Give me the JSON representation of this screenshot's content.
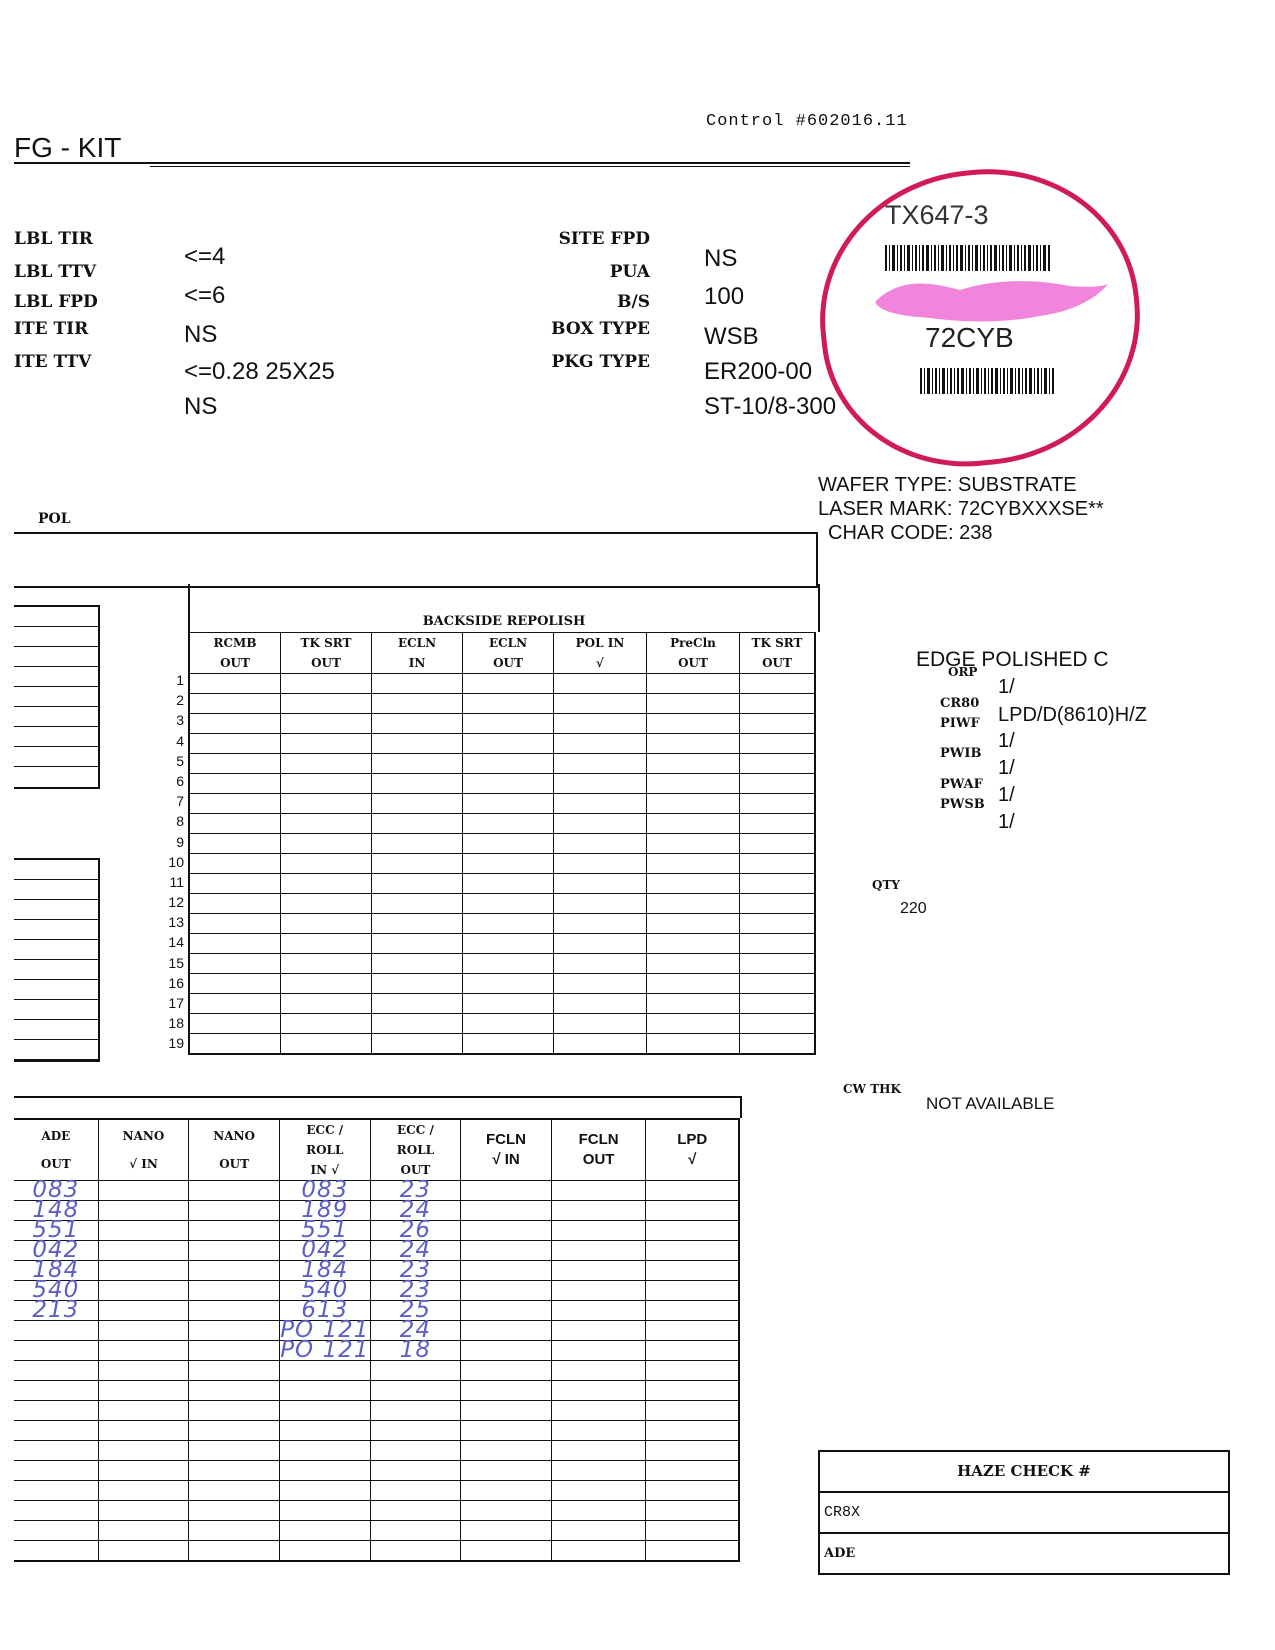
{
  "header": {
    "control": "Control #602016.11",
    "title": "FG - KIT"
  },
  "specs_left": [
    {
      "label": "LBL TIR",
      "value": "<=4"
    },
    {
      "label": "LBL TTV",
      "value": "<=6"
    },
    {
      "label": "LBL FPD",
      "value": "NS"
    },
    {
      "label": "ITE TIR",
      "value": "<=0.28 25X25"
    },
    {
      "label": "ITE TTV",
      "value": "NS"
    }
  ],
  "specs_right": [
    {
      "label": "SITE FPD",
      "value": "NS"
    },
    {
      "label": "PUA",
      "value": "100"
    },
    {
      "label": "B/S",
      "value": "WSB"
    },
    {
      "label": "BOX TYPE",
      "value": "ER200-00"
    },
    {
      "label": "PKG TYPE",
      "value": "ST-10/8-300"
    }
  ],
  "stamp": {
    "id": "TX647-3",
    "code": "72CYB",
    "color": "#d11a5a",
    "smear_color": "#ee6fd6"
  },
  "wafer_info": {
    "wafer_type": "WAFER TYPE: SUBSTRATE",
    "laser_mark": "LASER MARK: 72CYBXXXSE**",
    "char_code": "CHAR CODE: 238"
  },
  "pol_label": "POL",
  "backside": {
    "title": "BACKSIDE REPOLISH",
    "columns": [
      {
        "top": "RCMB",
        "bottom": "OUT"
      },
      {
        "top": "TK SRT",
        "bottom": "OUT"
      },
      {
        "top": "ECLN",
        "bottom": "IN"
      },
      {
        "top": "ECLN",
        "bottom": "OUT"
      },
      {
        "top": "POL IN",
        "bottom": "√"
      },
      {
        "top": "PreCln",
        "bottom": "OUT"
      },
      {
        "top": "TK SRT",
        "bottom": "OUT"
      }
    ],
    "row_numbers": [
      "1",
      "2",
      "3",
      "4",
      "5",
      "6",
      "7",
      "8",
      "9",
      "10",
      "11",
      "12",
      "13",
      "14",
      "15",
      "16",
      "17",
      "18",
      "19"
    ]
  },
  "edge": {
    "title": "EDGE POLISHED C",
    "rows": [
      {
        "label": "ORP",
        "value": "1/"
      },
      {
        "label": "CR80",
        "value": ""
      },
      {
        "label": "PIWF",
        "value": "LPD/D(8610)H/Z"
      },
      {
        "label": "PWIB",
        "value": "1/"
      },
      {
        "label": "",
        "value": "1/"
      },
      {
        "label": "PWAF",
        "value": "1/"
      },
      {
        "label": "PWSB",
        "value": "1/"
      }
    ]
  },
  "qty": {
    "label": "QTY",
    "value": "220"
  },
  "cw_thk": {
    "label": "CW THK",
    "value": "NOT AVAILABLE"
  },
  "lower": {
    "columns": [
      {
        "top": "ADE",
        "bottom": "OUT"
      },
      {
        "top": "NANO",
        "bottom": "√ IN"
      },
      {
        "top": "NANO",
        "bottom": "OUT"
      },
      {
        "top": "ECC /",
        "mid": "ROLL",
        "bottom": "IN √"
      },
      {
        "top": "ECC /",
        "mid": "ROLL",
        "bottom": "OUT"
      },
      {
        "top": "FCLN",
        "bottom": "√ IN"
      },
      {
        "top": "FCLN",
        "bottom": "OUT"
      },
      {
        "top": "LPD",
        "bottom": "√"
      }
    ],
    "handwritten": {
      "ade_out": [
        "083",
        "148",
        "551",
        "042",
        "184",
        "540",
        "213"
      ],
      "ecc_roll_in": [
        "083",
        "189",
        "551",
        "042",
        "184",
        "540",
        "613",
        "PO 121",
        "PO 121"
      ],
      "ecc_roll_out": [
        "23",
        "24",
        "26",
        "24",
        "23",
        "23",
        "25",
        "24",
        "18"
      ]
    }
  },
  "haze": {
    "title": "HAZE CHECK #",
    "rows": [
      "CR8X",
      "ADE"
    ]
  }
}
